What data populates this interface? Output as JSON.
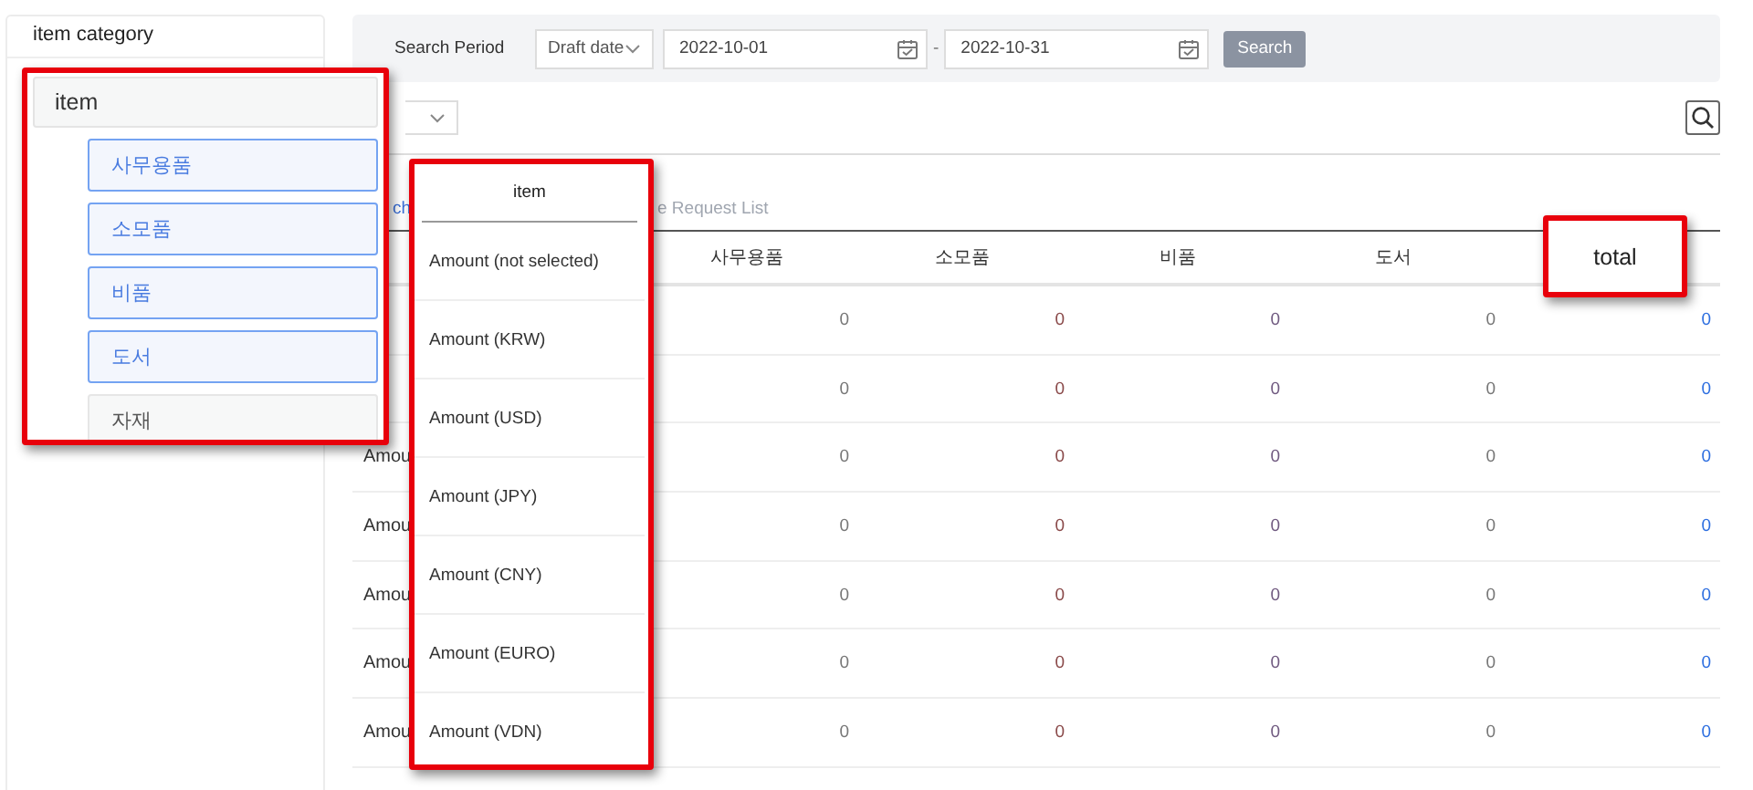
{
  "sidebar": {
    "title": "item category"
  },
  "search_bar": {
    "label": "Search Period",
    "date_type": "Draft date",
    "start_date": "2022-10-01",
    "separator": "-",
    "end_date": "2022-10-31",
    "button": "Search"
  },
  "tabs": [
    {
      "label": "ch",
      "selected": true
    },
    {
      "label": "e Request List",
      "selected": false
    }
  ],
  "table": {
    "columns": [
      "사무용품",
      "소모품",
      "비품",
      "도서"
    ],
    "rows": [
      {
        "cells": [
          "0",
          "0",
          "0",
          "0",
          "0"
        ]
      },
      {
        "cells": [
          "0",
          "0",
          "0",
          "0",
          "0"
        ]
      },
      {
        "label": "Amou",
        "cells": [
          "0",
          "0",
          "0",
          "0",
          "0"
        ]
      },
      {
        "label": "Amou",
        "cells": [
          "0",
          "0",
          "0",
          "0",
          "0"
        ]
      },
      {
        "label": "Amou",
        "cells": [
          "0",
          "0",
          "0",
          "0",
          "0"
        ]
      },
      {
        "label": "Amou",
        "cells": [
          "0",
          "0",
          "0",
          "0",
          "0"
        ]
      },
      {
        "label": "Amou",
        "cells": [
          "0",
          "0",
          "0",
          "0",
          "0"
        ]
      }
    ]
  },
  "callouts": [
    {
      "kind": "category",
      "header": "item",
      "items": [
        {
          "label": "사무용품",
          "selected": true
        },
        {
          "label": "소모품",
          "selected": true
        },
        {
          "label": "비품",
          "selected": true
        },
        {
          "label": "도서",
          "selected": true
        },
        {
          "label": "자재",
          "selected": false
        }
      ]
    },
    {
      "kind": "list",
      "header": "item",
      "items": [
        "Amount (not selected)",
        "Amount (KRW)",
        "Amount (USD)",
        "Amount (JPY)",
        "Amount (CNY)",
        "Amount (EURO)",
        "Amount (VDN)"
      ]
    },
    {
      "kind": "label",
      "text": "total"
    }
  ]
}
